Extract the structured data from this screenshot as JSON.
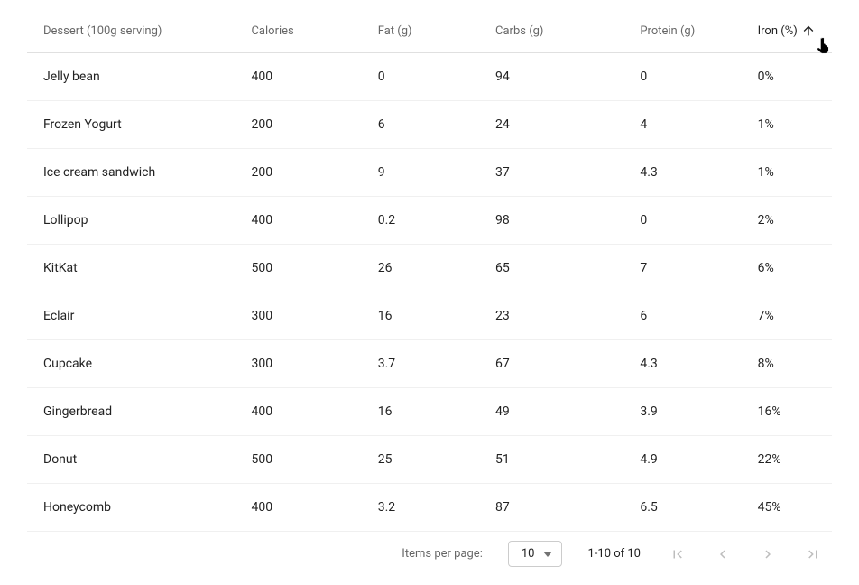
{
  "table": {
    "headers": {
      "dessert": "Dessert (100g serving)",
      "calories": "Calories",
      "fat": "Fat (g)",
      "carbs": "Carbs (g)",
      "protein": "Protein (g)",
      "iron": "Iron (%)"
    },
    "sort": {
      "column": "iron",
      "direction": "asc"
    },
    "rows": [
      {
        "dessert": "Jelly bean",
        "calories": "400",
        "fat": "0",
        "carbs": "94",
        "protein": "0",
        "iron": "0%"
      },
      {
        "dessert": "Frozen Yogurt",
        "calories": "200",
        "fat": "6",
        "carbs": "24",
        "protein": "4",
        "iron": "1%"
      },
      {
        "dessert": "Ice cream sandwich",
        "calories": "200",
        "fat": "9",
        "carbs": "37",
        "protein": "4.3",
        "iron": "1%"
      },
      {
        "dessert": "Lollipop",
        "calories": "400",
        "fat": "0.2",
        "carbs": "98",
        "protein": "0",
        "iron": "2%"
      },
      {
        "dessert": "KitKat",
        "calories": "500",
        "fat": "26",
        "carbs": "65",
        "protein": "7",
        "iron": "6%"
      },
      {
        "dessert": "Eclair",
        "calories": "300",
        "fat": "16",
        "carbs": "23",
        "protein": "6",
        "iron": "7%"
      },
      {
        "dessert": "Cupcake",
        "calories": "300",
        "fat": "3.7",
        "carbs": "67",
        "protein": "4.3",
        "iron": "8%"
      },
      {
        "dessert": "Gingerbread",
        "calories": "400",
        "fat": "16",
        "carbs": "49",
        "protein": "3.9",
        "iron": "16%"
      },
      {
        "dessert": "Donut",
        "calories": "500",
        "fat": "25",
        "carbs": "51",
        "protein": "4.9",
        "iron": "22%"
      },
      {
        "dessert": "Honeycomb",
        "calories": "400",
        "fat": "3.2",
        "carbs": "87",
        "protein": "6.5",
        "iron": "45%"
      }
    ]
  },
  "paginator": {
    "items_per_page_label": "Items per page:",
    "page_size": "10",
    "range_label": "1-10 of 10"
  }
}
